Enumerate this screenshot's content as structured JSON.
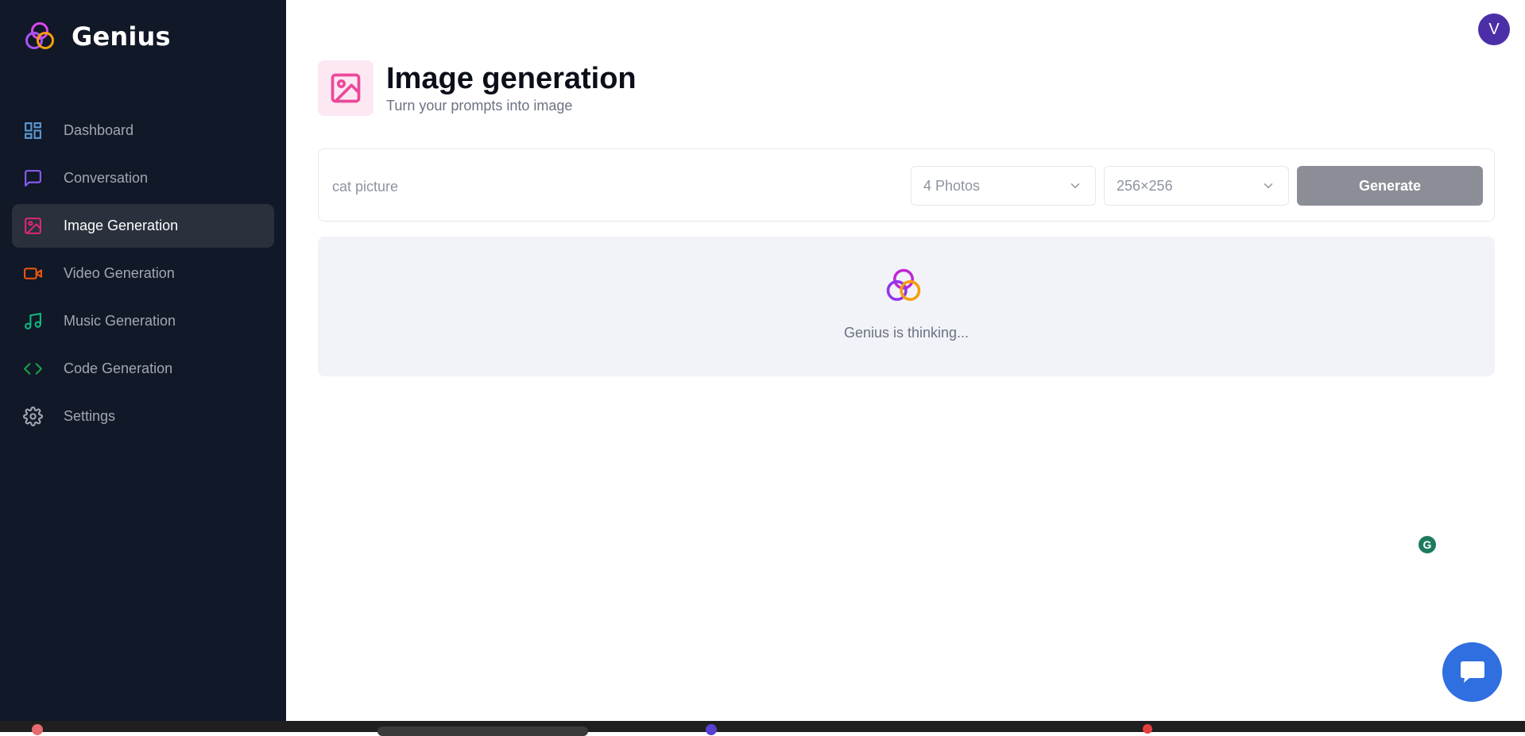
{
  "app": {
    "name": "Genius"
  },
  "sidebar": {
    "items": [
      {
        "label": "Dashboard",
        "icon": "layout-dashboard-icon",
        "color": "#5b9bd5",
        "active": false
      },
      {
        "label": "Conversation",
        "icon": "message-square-icon",
        "color": "#8b5cf6",
        "active": false
      },
      {
        "label": "Image Generation",
        "icon": "image-icon",
        "color": "#db2777",
        "active": true
      },
      {
        "label": "Video Generation",
        "icon": "video-icon",
        "color": "#ea580c",
        "active": false
      },
      {
        "label": "Music Generation",
        "icon": "music-icon",
        "color": "#10b981",
        "active": false
      },
      {
        "label": "Code Generation",
        "icon": "code-icon",
        "color": "#16a34a",
        "active": false
      },
      {
        "label": "Settings",
        "icon": "gear-icon",
        "color": "#a1a7b3",
        "active": false
      }
    ]
  },
  "header": {
    "avatar_letter": "V"
  },
  "page": {
    "title": "Image generation",
    "subtitle": "Turn your prompts into image",
    "icon": "image-icon",
    "accent": "#ec4899"
  },
  "form": {
    "prompt_value": "cat picture",
    "prompt_placeholder": "",
    "amount_selected": "4 Photos",
    "resolution_selected": "256×256",
    "generate_label": "Generate"
  },
  "loader": {
    "text": "Genius is thinking..."
  },
  "floating": {
    "grammarly_letter": "G",
    "chat_icon": "chat-bubble-icon"
  }
}
